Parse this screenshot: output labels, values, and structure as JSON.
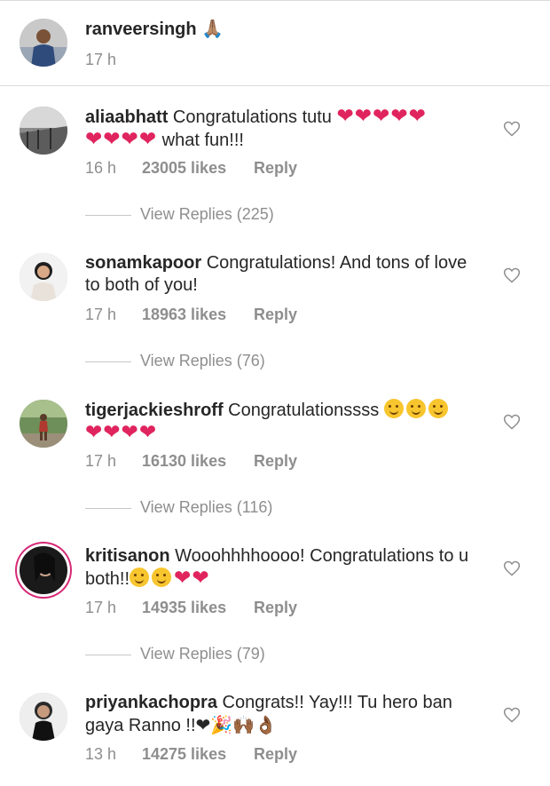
{
  "caption": {
    "username": "ranveersingh",
    "emoji": "🙏🏽",
    "time": "17 h"
  },
  "comments": [
    {
      "username": "aliaabhatt",
      "line1": "Congratulations tutu",
      "line1_emoji": "❤❤❤❤❤",
      "line2_emoji": "❤❤❤❤",
      "line2": " what fun!!!",
      "time": "16 h",
      "likes": "23005 likes",
      "reply": "Reply",
      "view_replies": "View Replies (225)"
    },
    {
      "username": "sonamkapoor",
      "line1": "Congratulations! And tons of love",
      "line2": "to both of you!",
      "time": "17 h",
      "likes": "18963 likes",
      "reply": "Reply",
      "view_replies": "View Replies (76)"
    },
    {
      "username": "tigerjackieshroff",
      "line1": "Congratulationssss",
      "line1_emoji": "🤗🤗🤗",
      "line2_emoji": "❤❤❤❤",
      "time": "17 h",
      "likes": "16130 likes",
      "reply": "Reply",
      "view_replies": "View Replies (116)"
    },
    {
      "username": "kritisanon",
      "line1": "Wooohhhhoooo! Congratulations to u",
      "line2": "both!!",
      "line2_emoji": "🤗🤗❤❤",
      "time": "17 h",
      "likes": "14935 likes",
      "reply": "Reply",
      "view_replies": "View Replies (79)"
    },
    {
      "username": "priyankachopra",
      "line1": "Congrats!! Yay!!! Tu hero ban",
      "line2": "gaya Ranno !!",
      "line2_emoji": "❤🎉🙌🏾👌🏾",
      "time": "13 h",
      "likes": "14275 likes",
      "reply": "Reply"
    }
  ],
  "colors": {
    "heart": "#e0245e",
    "muted": "#8e8e8e",
    "text": "#262626",
    "story_ring": "#d62976"
  },
  "icons": {
    "like": "heart-outline-icon"
  }
}
